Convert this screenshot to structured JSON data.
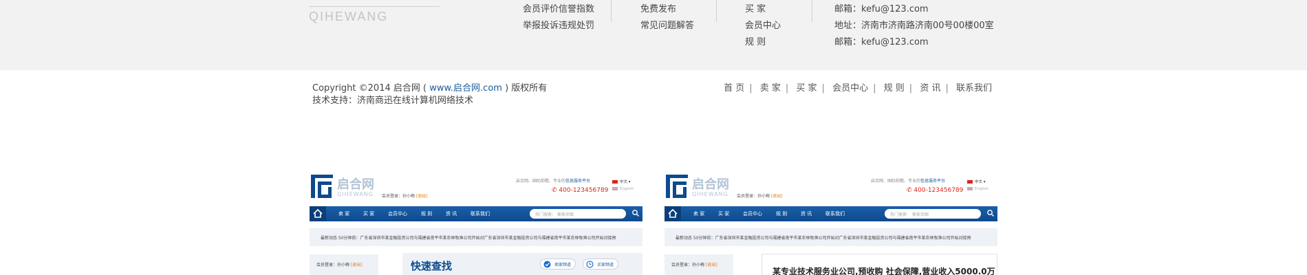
{
  "footer": {
    "brand_en": "QIHEWANG",
    "col1": [
      "会员评价信誉指数",
      "举报投诉违规处罚"
    ],
    "col2": [
      "免费发布",
      "常见问题解答"
    ],
    "col3": [
      "买 家",
      "会员中心",
      "规 则"
    ],
    "col4": [
      "邮箱：kefu@123.com",
      "地址：济南市济南路济南00号00楼00室",
      "邮箱：kefu@123.com"
    ]
  },
  "copyright": {
    "prefix": "Copyright ©2014 启合网 (",
    "link": "www.启合网.com",
    "suffix": ") 版权所有",
    "tech": "技术支持：济南商迅在线计算机网络技术"
  },
  "bottom_nav": [
    "首 页",
    "卖 家",
    "买 家",
    "会员中心",
    "规 则",
    "资 讯",
    "联系我们"
  ],
  "thumb": {
    "cn": "启合网",
    "en": "QIHEWANG",
    "login_label": "会员登录：孙小梅",
    "login_exit": "[退出]",
    "slogan_a": "启合网、国际前瞻、专业的",
    "slogan_b": "信息服务平台",
    "phone": "400-123456789",
    "lang_cn": "中文",
    "lang_en": "English",
    "nav": [
      "卖 家",
      "买 家",
      "会员中心",
      "规 则",
      "资 讯",
      "联系我们"
    ],
    "search_placeholder": "热门搜索：  莫家涂图",
    "news": "最新动态  50分钟前：广东省深圳市某金融投资公司与福建省南平市某农林牧渔公司开始对广东省深圳市某金融投资公司与福建省南平市某农林牧渔公司开始对接预",
    "quick_title": "快速查找",
    "pill1": "卖家频道",
    "pill2": "买家频道",
    "card_text": "某专业技术服务业公司,预收购 社会保障,营业收入5000.0万"
  },
  "colors": {
    "brand_blue": "#0e4a8d",
    "phone_red": "#d9261c",
    "accent_orange": "#e07a10"
  }
}
